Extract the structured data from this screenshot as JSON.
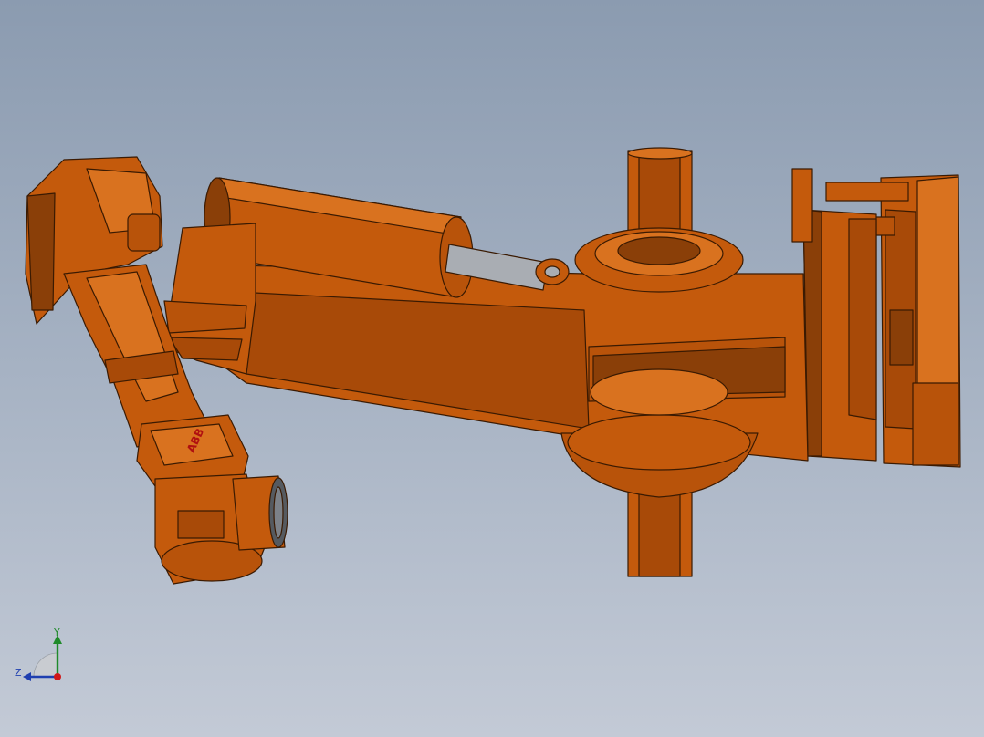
{
  "viewport": {
    "background_top": "#8b9bb0",
    "background_bottom": "#c3cad6"
  },
  "model": {
    "part_color": "#c45a0c",
    "part_shadow_color": "#8a3f08",
    "part_highlight_color": "#d9721f",
    "edge_color": "#3a1a02",
    "piston_rod_color": "#a9adb3",
    "brand_logo_text": "ABB",
    "brand_logo_color": "#b01010"
  },
  "triad": {
    "y_label": "Y",
    "z_label": "Z",
    "y_color": "#1f8a2a",
    "z_color": "#1f3fb0",
    "x_color": "#d01818"
  }
}
